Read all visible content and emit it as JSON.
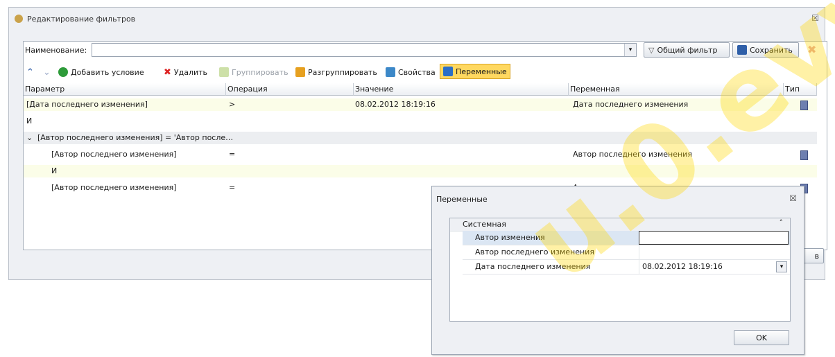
{
  "window": {
    "title": "Редактирование фильтров",
    "close": "☒"
  },
  "name_row": {
    "label": "Наименование:",
    "value": ""
  },
  "buttons": {
    "common_filter": "Общий фильтр",
    "save": "Сохранить",
    "cancel_partial": "в"
  },
  "toolbar": {
    "add": "Добавить условие",
    "delete": "Удалить",
    "group": "Группировать",
    "ungroup": "Разгруппировать",
    "props": "Свойства",
    "vars": "Переменные"
  },
  "columns": [
    "Параметр",
    "Операция",
    "Значение",
    "Переменная",
    "Тип"
  ],
  "rows": [
    {
      "param": "[Дата последнего изменения]",
      "op": ">",
      "value": "08.02.2012 18:19:16",
      "var": "Дата последнего изменения",
      "indent": 0,
      "type": true
    },
    {
      "param": "И",
      "op": "",
      "value": "",
      "var": "",
      "indent": 0,
      "type": false
    },
    {
      "param": "[Автор последнего изменения] = 'Автор после…",
      "op": "",
      "value": "",
      "var": "",
      "indent": -1,
      "type": false
    },
    {
      "param": "[Автор последнего изменения]",
      "op": "=",
      "value": "",
      "var": "Автор последнего изменения",
      "indent": 1,
      "type": true
    },
    {
      "param": "И",
      "op": "",
      "value": "",
      "var": "",
      "indent": 1,
      "type": false
    },
    {
      "param": "[Автор последнего изменения]",
      "op": "=",
      "value": "",
      "var": "Автор изменения",
      "indent": 1,
      "type": true
    }
  ],
  "popup": {
    "title": "Переменные",
    "close": "☒",
    "category": "Системная",
    "items": [
      {
        "label": "Автор изменения",
        "value": ""
      },
      {
        "label": "Автор последнего изменения",
        "value": ""
      },
      {
        "label": "Дата последнего изменения",
        "value": "08.02.2012 18:19:16"
      }
    ],
    "ok": "OK"
  },
  "watermark": "u.0.evv"
}
